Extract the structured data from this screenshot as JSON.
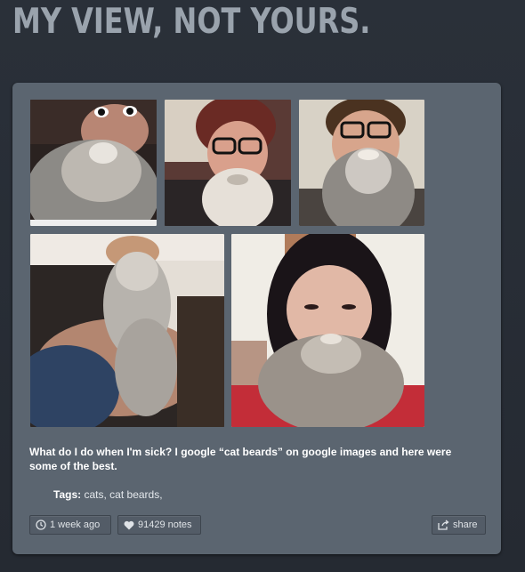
{
  "blog": {
    "title": "MY VIEW, NOT YOURS."
  },
  "post": {
    "caption": "What do I do when I'm sick? I google “cat beards” on google images and here were some of the best.",
    "tags_label": "Tags:",
    "tags": [
      "cats",
      "cat beards"
    ],
    "time_label": "1 week ago",
    "notes_label": "91429 notes",
    "share_label": "share",
    "photos": [
      {
        "name": "cat-beard-photo-1",
        "icons": "clock-icon"
      },
      {
        "name": "cat-beard-photo-2"
      },
      {
        "name": "cat-beard-photo-3"
      },
      {
        "name": "cat-beard-photo-4"
      },
      {
        "name": "cat-beard-photo-5"
      }
    ]
  },
  "colors": {
    "background": "#262b33",
    "card": "#5b6570",
    "title": "#9aa3ad"
  },
  "icons": {
    "time": "clock-icon",
    "notes": "heart-icon",
    "share": "share-icon"
  }
}
